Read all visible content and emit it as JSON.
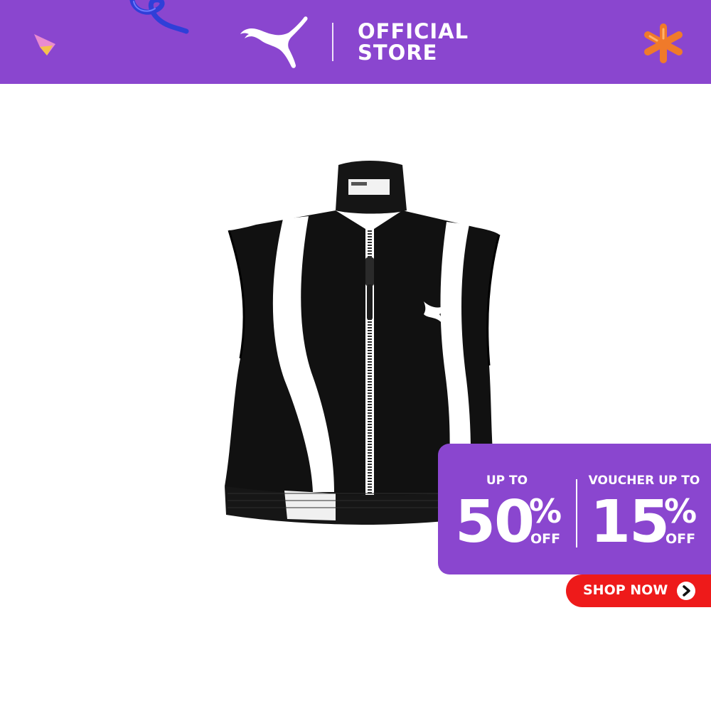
{
  "header": {
    "background_color": "#8a46cf",
    "store_line1": "OFFICIAL",
    "store_line2": "STORE",
    "logo_icon": "puma-logo-icon"
  },
  "product": {
    "image_icon": "black-white-cropped-zip-vest-image",
    "colors": [
      "#111111",
      "#ffffff"
    ]
  },
  "promo": {
    "background_color": "#8a46cf",
    "discount": {
      "label": "UP TO",
      "value": "50",
      "percent": "%",
      "suffix": "OFF"
    },
    "voucher": {
      "label": "VOUCHER UP TO",
      "value": "15",
      "percent": "%",
      "suffix": "OFF"
    }
  },
  "cta": {
    "label": "SHOP NOW",
    "icon": "chevron-right-icon",
    "color": "#ee1a1a"
  }
}
